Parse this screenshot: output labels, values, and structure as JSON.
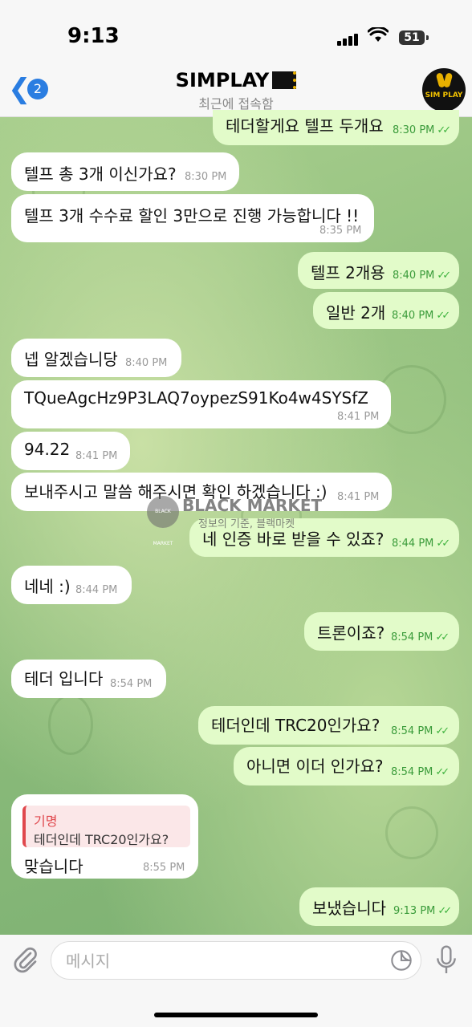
{
  "status_bar": {
    "time": "9:13",
    "battery": "51"
  },
  "header": {
    "back_count": "2",
    "title": "SIMPLAY",
    "subtitle": "최근에 접속함",
    "avatar_text": "SIM PLAY"
  },
  "messages": [
    {
      "dir": "out",
      "text": "테더할게요 텔프 두개요",
      "time": "8:30 PM"
    },
    {
      "dir": "in",
      "text": "텔프 총 3개 이신가요?",
      "time": "8:30 PM"
    },
    {
      "dir": "in",
      "text": "텔프 3개 수수료 할인 3만으로 진행 가능합니다 !!",
      "time": "8:35 PM"
    },
    {
      "dir": "out",
      "text": "텔프 2개용",
      "time": "8:40 PM"
    },
    {
      "dir": "out",
      "text": "일반 2개",
      "time": "8:40 PM"
    },
    {
      "dir": "in",
      "text": "넵 알겠습니당",
      "time": "8:40 PM"
    },
    {
      "dir": "in",
      "text": "TQueAgcHz9P3LAQ7oypezS91Ko4w4SYSfZ",
      "time": "8:41 PM"
    },
    {
      "dir": "in",
      "text": "94.22",
      "time": "8:41 PM"
    },
    {
      "dir": "in",
      "text": "보내주시고 말씀 해주시면 확인 하겠습니다 :)",
      "time": "8:41 PM"
    },
    {
      "dir": "out",
      "text": "네 인증 바로 받을 수 있죠?",
      "time": "8:44 PM"
    },
    {
      "dir": "in",
      "text": "네네 :)",
      "time": "8:44 PM"
    },
    {
      "dir": "out",
      "text": "트론이죠?",
      "time": "8:54 PM"
    },
    {
      "dir": "in",
      "text": "테더 입니다",
      "time": "8:54 PM"
    },
    {
      "dir": "out",
      "text": "테더인데 TRC20인가요?",
      "time": "8:54 PM"
    },
    {
      "dir": "out",
      "text": "아니면 이더 인가요?",
      "time": "8:54 PM"
    },
    {
      "dir": "in",
      "text": "맞습니다",
      "time": "8:55 PM",
      "reply_name": "기명",
      "reply_text": "테더인데 TRC20인가요?"
    },
    {
      "dir": "out",
      "text": "보냈습니다",
      "time": "9:13 PM"
    }
  ],
  "watermark": {
    "title": "BLACK MARKET",
    "subtitle": "정보의 기준, 블랙마켓",
    "badge": "BLACK MARKET"
  },
  "composer": {
    "placeholder": "메시지"
  }
}
